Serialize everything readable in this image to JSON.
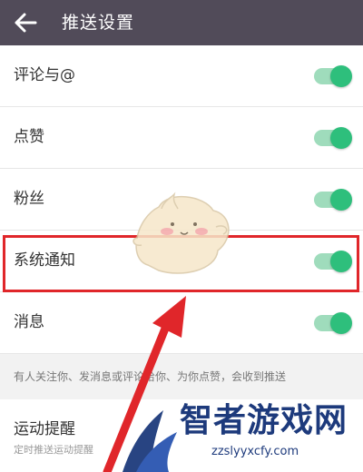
{
  "header": {
    "title": "推送设置"
  },
  "settings": [
    {
      "label": "评论与@",
      "on": true
    },
    {
      "label": "点赞",
      "on": true
    },
    {
      "label": "粉丝",
      "on": true
    },
    {
      "label": "系统通知",
      "on": true
    },
    {
      "label": "消息",
      "on": true
    }
  ],
  "hint": "有人关注你、发消息或评论给你、为你点赞，会收到推送",
  "sport": {
    "label": "运动提醒",
    "sub": "定时推送运动提醒"
  },
  "watermark": {
    "text": "智者游戏网",
    "url": "zzslyyxcfy.com"
  },
  "colors": {
    "header_bg": "#514b59",
    "toggle_on": "#2ebf7c",
    "highlight": "#e0262a"
  }
}
